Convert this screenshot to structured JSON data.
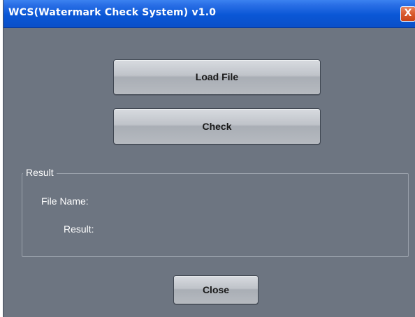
{
  "window": {
    "title": "WCS(Watermark Check System) v1.0",
    "close_glyph": "X"
  },
  "buttons": {
    "load_file": "Load File",
    "check": "Check",
    "close": "Close"
  },
  "result_group": {
    "legend": "Result",
    "file_name_label": "File Name:",
    "result_label": "Result:"
  },
  "colors": {
    "titlebar": "#0a57d6",
    "window_bg": "#6d7581",
    "close_button": "#d95a2e"
  },
  "icons": {
    "title_close": "close-icon"
  }
}
